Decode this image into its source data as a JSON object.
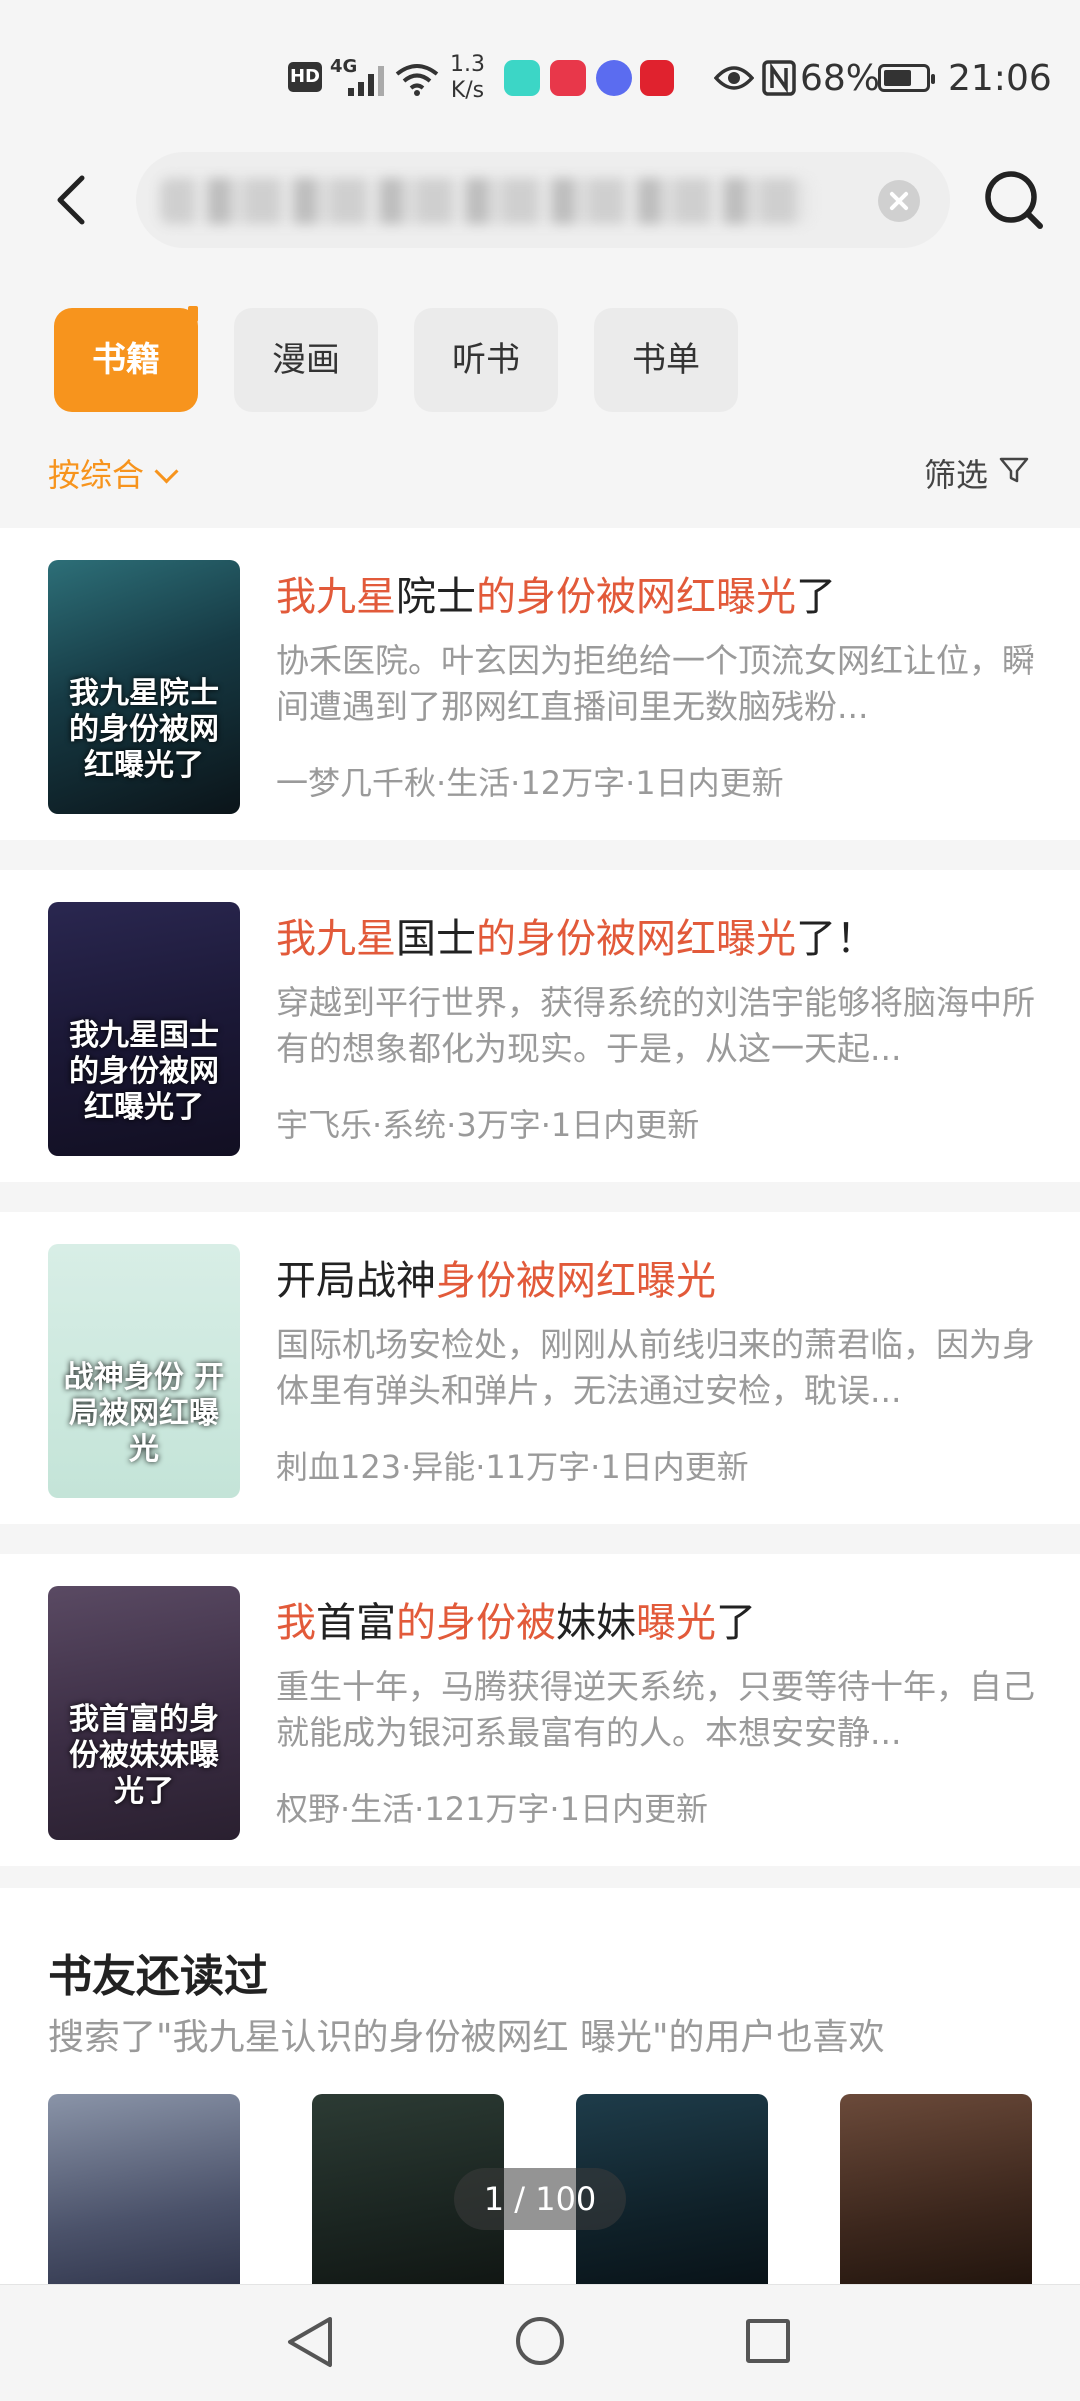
{
  "status_bar": {
    "hd": "HD",
    "network": "4G",
    "speed_value": "1.3",
    "speed_unit": "K/s",
    "battery_percent": "68%",
    "battery_level": 0.68,
    "time": "21:06"
  },
  "search": {
    "query_visible": false
  },
  "tabs": [
    {
      "label": "书籍",
      "active": true
    },
    {
      "label": "漫画",
      "active": false
    },
    {
      "label": "听书",
      "active": false
    },
    {
      "label": "书单",
      "active": false
    }
  ],
  "sort_label": "按综合",
  "filter_label": "筛选",
  "books": [
    {
      "title_parts": [
        {
          "text": "我九星",
          "hl": true
        },
        {
          "text": "院士",
          "hl": false
        },
        {
          "text": "的身份被网红曝光",
          "hl": true
        },
        {
          "text": "了",
          "hl": false
        }
      ],
      "desc": "协禾医院。叶玄因为拒绝给一个顶流女网红让位，瞬间遭遇到了那网红直播间里无数脑残粉...",
      "meta": "一梦几千秋·生活·12万字·1日内更新",
      "cover_text": "我九星院士的身份被网红曝光了",
      "cover_bg": "linear-gradient(160deg,#2d6f78 0%,#163a44 45%,#0b1419 100%)"
    },
    {
      "title_parts": [
        {
          "text": "我九星",
          "hl": true
        },
        {
          "text": "国士",
          "hl": false
        },
        {
          "text": "的身份被网红曝光",
          "hl": true
        },
        {
          "text": "了！",
          "hl": false
        }
      ],
      "desc": "穿越到平行世界，获得系统的刘浩宇能够将脑海中所有的想象都化为现实。于是，从这一天起...",
      "meta": "宇飞乐·系统·3万字·1日内更新",
      "cover_text": "我九星国士的身份被网红曝光了",
      "cover_bg": "linear-gradient(170deg,#2a2750 0%,#1b1836 50%,#120f22 100%)"
    },
    {
      "title_parts": [
        {
          "text": "开局战神",
          "hl": false
        },
        {
          "text": "身份被网红曝光",
          "hl": true
        }
      ],
      "desc": "国际机场安检处，刚刚从前线归来的萧君临，因为身体里有弹头和弹片，无法通过安检，耽误...",
      "meta": "刺血123·异能·11万字·1日内更新",
      "cover_text": "战神身份 开局被网红曝光",
      "cover_bg": "linear-gradient(180deg,#d8eee6 0%,#c4e4d8 100%)"
    },
    {
      "title_parts": [
        {
          "text": "我",
          "hl": true
        },
        {
          "text": "首富",
          "hl": false
        },
        {
          "text": "的身份被",
          "hl": true
        },
        {
          "text": "妹妹",
          "hl": false
        },
        {
          "text": "曝光",
          "hl": true
        },
        {
          "text": "了",
          "hl": false
        }
      ],
      "desc": "重生十年，马腾获得逆天系统，只要等待十年，自己就能成为银河系最富有的人。本想安安静...",
      "meta": "权野·生活·121万字·1日内更新",
      "cover_text": "我首富的身份被妹妹曝光了",
      "cover_bg": "linear-gradient(170deg,#5a4a63 0%,#3b2d44 55%,#2a2030 100%)"
    }
  ],
  "also_read": {
    "title": "书友还读过",
    "subtitle": "搜索了\"我九星认识的身份被网红 曝光\"的用户也喜欢",
    "covers": [
      {
        "bg": "linear-gradient(170deg,#8a94a8 0%,#4b526a 60%,#2d3248 100%)"
      },
      {
        "bg": "linear-gradient(170deg,#2c3b34 0%,#1a2420 60%,#101512 100%)"
      },
      {
        "bg": "linear-gradient(170deg,#1e3c4a 0%,#0f2028 60%,#081116 100%)"
      },
      {
        "bg": "linear-gradient(170deg,#6b4a3a 0%,#3b261c 60%,#1f130c 100%)"
      }
    ]
  },
  "pager": "1 / 100",
  "colors": {
    "accent": "#f7941d",
    "highlight": "#e25a3a",
    "muted": "#9a9a9a"
  }
}
